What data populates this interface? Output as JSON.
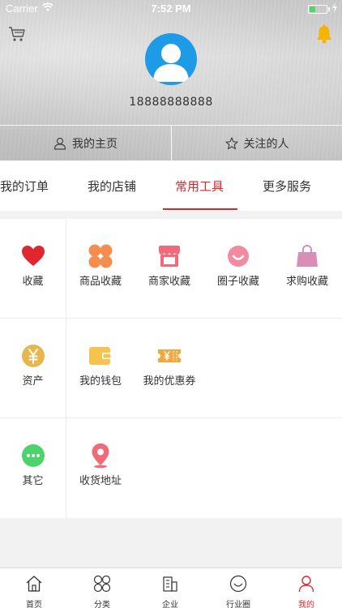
{
  "status_bar": {
    "carrier": "Carrier",
    "time": "7:52 PM",
    "battery_level": 0.35
  },
  "header": {
    "cart_icon": "cart-icon",
    "bell_icon": "bell-icon",
    "avatar_icon": "user-avatar-icon",
    "phone": "18888888888",
    "links": [
      {
        "label": "我的主页",
        "icon": "user-outline-icon"
      },
      {
        "label": "关注的人",
        "icon": "star-outline-icon"
      }
    ]
  },
  "tabs": [
    {
      "label": "我的订单",
      "active": false
    },
    {
      "label": "我的店铺",
      "active": false
    },
    {
      "label": "常用工具",
      "active": true
    },
    {
      "label": "更多服务",
      "active": false
    }
  ],
  "tools": [
    [
      {
        "label": "收藏",
        "icon": "heart-icon"
      },
      {
        "label": "商品收藏",
        "icon": "clover-icon"
      },
      {
        "label": "商家收藏",
        "icon": "shop-icon"
      },
      {
        "label": "圈子收藏",
        "icon": "smile-icon"
      },
      {
        "label": "求购收藏",
        "icon": "bag-icon"
      }
    ],
    [
      {
        "label": "资产",
        "icon": "yuan-coin-icon"
      },
      {
        "label": "我的钱包",
        "icon": "wallet-icon"
      },
      {
        "label": "我的优惠券",
        "icon": "coupon-icon"
      }
    ],
    [
      {
        "label": "其它",
        "icon": "more-dots-icon"
      },
      {
        "label": "收货地址",
        "icon": "location-pin-icon"
      }
    ]
  ],
  "bottom_nav": [
    {
      "label": "首页",
      "icon": "home-icon",
      "active": false
    },
    {
      "label": "分类",
      "icon": "category-icon",
      "active": false
    },
    {
      "label": "企业",
      "icon": "building-icon",
      "active": false
    },
    {
      "label": "行业圈",
      "icon": "circle-icon",
      "active": false
    },
    {
      "label": "我的",
      "icon": "person-icon",
      "active": true
    }
  ],
  "colors": {
    "accent": "#e0272f",
    "avatar_bg": "#1e9be6",
    "bell": "#f5b400",
    "heart": "#e0272f",
    "clover": "#f58d4f",
    "shop": "#f06a7a",
    "smile": "#f28aa0",
    "bag": "#d98eb8",
    "coin": "#e8b64c",
    "wallet": "#f5c34e",
    "coupon": "#f2a93b",
    "more": "#4cd36b",
    "pin": "#f06a7a"
  }
}
